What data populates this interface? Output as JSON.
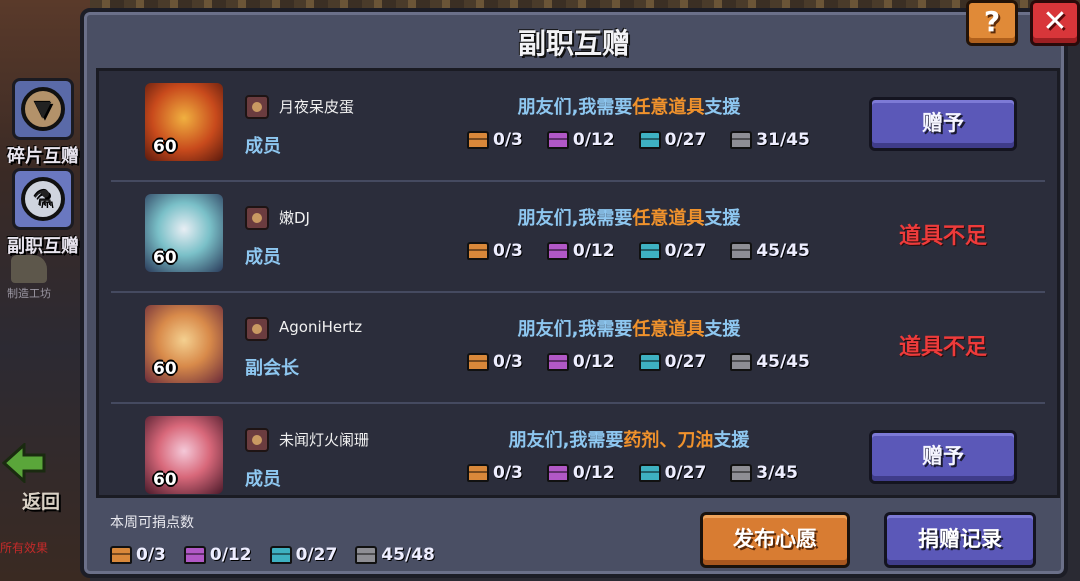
{
  "sidebar": {
    "tabs": [
      {
        "label": "碎片互赠",
        "icon": "shield-arrow-icon"
      },
      {
        "label": "副职互赠",
        "icon": "potion-icon"
      }
    ],
    "workshop_label": "制造工坊",
    "back_label": "返回",
    "bottom_hint": "所有效果"
  },
  "panel": {
    "title": "副职互赠"
  },
  "requests": [
    {
      "player": "月夜呆皮蛋",
      "role": "成员",
      "level": "60",
      "request_prefix": "朋友们,我需要",
      "request_items": "任意道具",
      "request_suffix": "支援",
      "resources": [
        "0/3",
        "0/12",
        "0/27",
        "31/45"
      ],
      "action": "赠予",
      "status": ""
    },
    {
      "player": "嫩DJ",
      "role": "成员",
      "level": "60",
      "request_prefix": "朋友们,我需要",
      "request_items": "任意道具",
      "request_suffix": "支援",
      "resources": [
        "0/3",
        "0/12",
        "0/27",
        "45/45"
      ],
      "action": "",
      "status": "道具不足"
    },
    {
      "player": "AgoniHertz",
      "role": "副会长",
      "level": "60",
      "request_prefix": "朋友们,我需要",
      "request_items": "任意道具",
      "request_suffix": "支援",
      "resources": [
        "0/3",
        "0/12",
        "0/27",
        "45/45"
      ],
      "action": "",
      "status": "道具不足"
    },
    {
      "player": "未闻灯火阑珊",
      "role": "成员",
      "level": "60",
      "request_prefix": "朋友们,我需要",
      "request_items": "药剂、刀油",
      "request_suffix": "支援",
      "resources": [
        "0/3",
        "0/12",
        "0/27",
        "3/45"
      ],
      "action": "赠予",
      "status": ""
    }
  ],
  "footer": {
    "weekly_label": "本周可捐点数",
    "resources": [
      "0/3",
      "0/12",
      "0/27",
      "45/48"
    ],
    "wish_button": "发布心愿",
    "record_button": "捐赠记录"
  },
  "top_buttons": {
    "help": "?",
    "close": "✕"
  },
  "colors": {
    "panel_bg": "#4a4f64",
    "list_bg": "#2b2d3b",
    "accent_blue": "#8ec7f0",
    "highlight_orange": "#f0922c",
    "warning_red": "#ee3b3b",
    "button_purple": "#5b58b8",
    "button_orange": "#d87c32"
  },
  "resource_types": [
    "orange-chest-icon",
    "purple-chest-icon",
    "teal-chest-icon",
    "gray-chest-icon"
  ]
}
